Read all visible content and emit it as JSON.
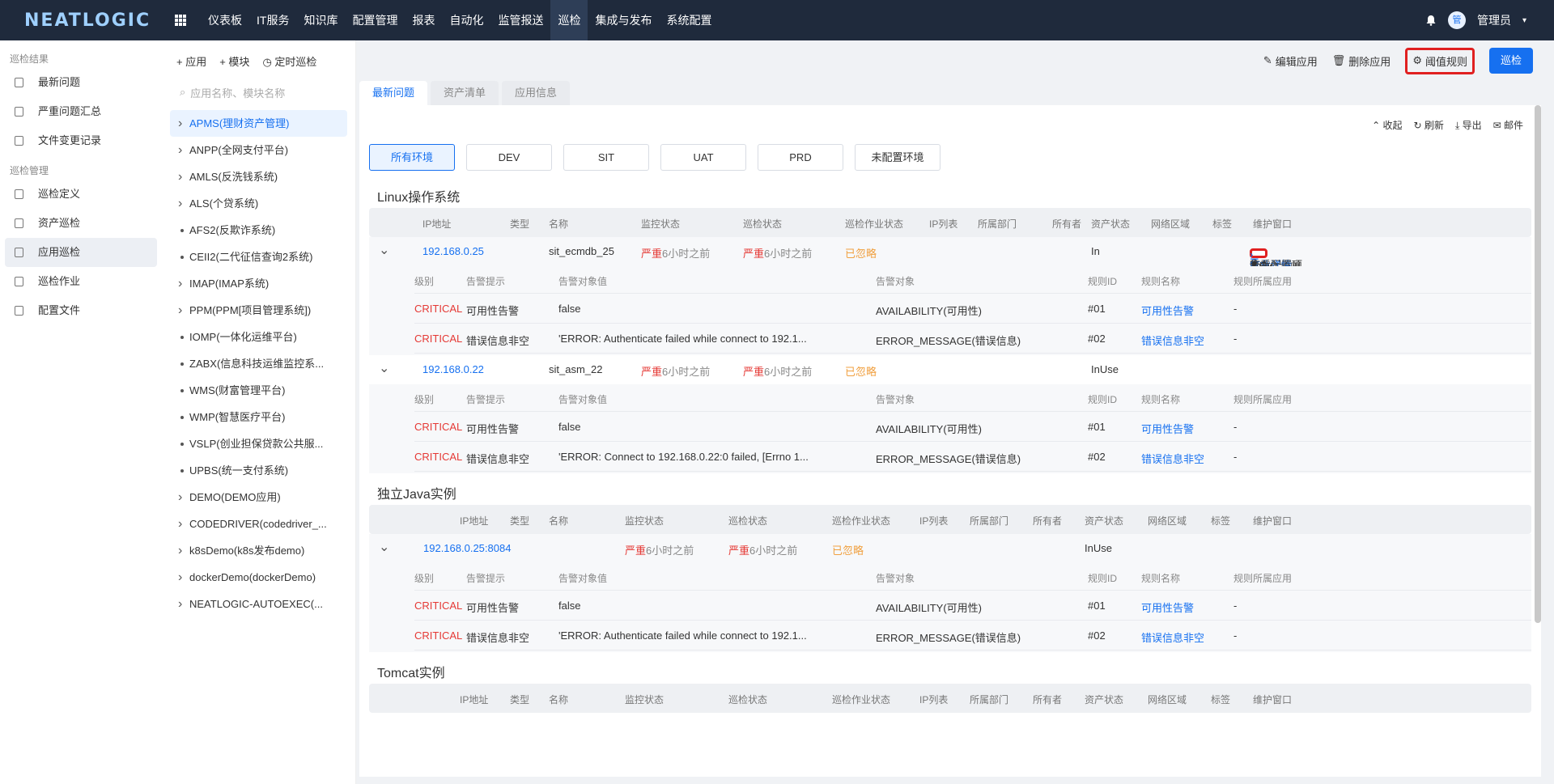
{
  "app": {
    "logo": "NEATLOGIC"
  },
  "topnav": {
    "items": [
      "仪表板",
      "IT服务",
      "知识库",
      "配置管理",
      "报表",
      "自动化",
      "监管报送",
      "巡检",
      "集成与发布",
      "系统配置"
    ],
    "active_index": 7,
    "user": {
      "avatar": "管",
      "name": "管理员"
    }
  },
  "leftnav": {
    "groups": [
      {
        "title": "巡检结果",
        "items": [
          "最新问题",
          "严重问题汇总",
          "文件变更记录"
        ]
      },
      {
        "title": "巡检管理",
        "items": [
          "巡检定义",
          "资产巡检",
          "应用巡检",
          "巡检作业",
          "配置文件"
        ]
      }
    ],
    "active": "应用巡检"
  },
  "tree": {
    "add_app": "+ 应用",
    "add_module": "+ 模块",
    "schedule": "定时巡检",
    "search_placeholder": "应用名称、模块名称",
    "items": [
      {
        "label": "APMS(理财资产管理)",
        "expand": true
      },
      {
        "label": "ANPP(全网支付平台)",
        "expand": true
      },
      {
        "label": "AMLS(反洗钱系统)",
        "expand": true
      },
      {
        "label": "ALS(个贷系统)",
        "expand": true
      },
      {
        "label": "AFS2(反欺诈系统)",
        "expand": false
      },
      {
        "label": "CEII2(二代征信查询2系统)",
        "expand": false
      },
      {
        "label": "IMAP(IMAP系统)",
        "expand": true
      },
      {
        "label": "PPM(PPM[项目管理系统])",
        "expand": true
      },
      {
        "label": "IOMP(一体化运维平台)",
        "expand": false
      },
      {
        "label": "ZABX(信息科技运维监控系...",
        "expand": false
      },
      {
        "label": "WMS(财富管理平台)",
        "expand": false
      },
      {
        "label": "WMP(智慧医疗平台)",
        "expand": false
      },
      {
        "label": "VSLP(创业担保贷款公共服...",
        "expand": false
      },
      {
        "label": "UPBS(统一支付系统)",
        "expand": false
      },
      {
        "label": "DEMO(DEMO应用)",
        "expand": true
      },
      {
        "label": "CODEDRIVER(codedriver_...",
        "expand": true
      },
      {
        "label": "k8sDemo(k8s发布demo)",
        "expand": true
      },
      {
        "label": "dockerDemo(dockerDemo)",
        "expand": true
      },
      {
        "label": "NEATLOGIC-AUTOEXEC(...",
        "expand": true
      }
    ],
    "active_index": 0
  },
  "toolbar": {
    "edit": "编辑应用",
    "delete": "删除应用",
    "threshold": "阈值规则",
    "inspect": "巡检"
  },
  "tabs": [
    "最新问题",
    "资产清单",
    "应用信息"
  ],
  "panel_actions": {
    "collapse": "收起",
    "refresh": "刷新",
    "export": "导出",
    "mail": "邮件"
  },
  "envs": [
    "所有环境",
    "DEV",
    "SIT",
    "UAT",
    "PRD",
    "未配置环境"
  ],
  "columns": [
    "IP地址",
    "类型",
    "名称",
    "监控状态",
    "巡检状态",
    "巡检作业状态",
    "IP列表",
    "所属部门",
    "所有者",
    "资产状态",
    "网络区域",
    "标签",
    "维护窗口"
  ],
  "sub_columns": [
    "级别",
    "告警提示",
    "告警对象值",
    "告警对象",
    "规则ID",
    "规则名称",
    "规则所属应用"
  ],
  "sections": [
    {
      "title": "Linux操作系统",
      "rows": [
        {
          "ip": "192.168.0.25",
          "name": "sit_ecmdb_25",
          "monitor": "严重",
          "monitor_time": "6小时之前",
          "inspect": "严重",
          "inspect_time": "6小时之前",
          "job": "已忽略",
          "asset": "In",
          "row_actions": {
            "threshold": "阈值规则",
            "job_detail": "作业详情",
            "config": "查看配置项"
          },
          "alerts": [
            {
              "level": "CRITICAL",
              "tip": "可用性告警",
              "value": "false",
              "object": "AVAILABILITY(可用性)",
              "rule_id": "#01",
              "rule_name": "可用性告警",
              "rule_app": "-"
            },
            {
              "level": "CRITICAL",
              "tip": "错误信息非空",
              "value": "'ERROR: Authenticate failed while connect to 192.1...",
              "object": "ERROR_MESSAGE(错误信息)",
              "rule_id": "#02",
              "rule_name": "错误信息非空",
              "rule_app": "-"
            }
          ]
        },
        {
          "ip": "192.168.0.22",
          "name": "sit_asm_22",
          "monitor": "严重",
          "monitor_time": "6小时之前",
          "inspect": "严重",
          "inspect_time": "6小时之前",
          "job": "已忽略",
          "asset": "InUse",
          "alerts": [
            {
              "level": "CRITICAL",
              "tip": "可用性告警",
              "value": "false",
              "object": "AVAILABILITY(可用性)",
              "rule_id": "#01",
              "rule_name": "可用性告警",
              "rule_app": "-"
            },
            {
              "level": "CRITICAL",
              "tip": "错误信息非空",
              "value": "'ERROR: Connect to 192.168.0.22:0 failed, [Errno 1...",
              "object": "ERROR_MESSAGE(错误信息)",
              "rule_id": "#02",
              "rule_name": "错误信息非空",
              "rule_app": "-"
            }
          ]
        }
      ]
    },
    {
      "title": "独立Java实例",
      "rows": [
        {
          "ip": "192.168.0.25:8084",
          "name": "",
          "monitor": "严重",
          "monitor_time": "6小时之前",
          "inspect": "严重",
          "inspect_time": "6小时之前",
          "job": "已忽略",
          "asset": "InUse",
          "alerts": [
            {
              "level": "CRITICAL",
              "tip": "可用性告警",
              "value": "false",
              "object": "AVAILABILITY(可用性)",
              "rule_id": "#01",
              "rule_name": "可用性告警",
              "rule_app": "-"
            },
            {
              "level": "CRITICAL",
              "tip": "错误信息非空",
              "value": "'ERROR: Authenticate failed while connect to 192.1...",
              "object": "ERROR_MESSAGE(错误信息)",
              "rule_id": "#02",
              "rule_name": "错误信息非空",
              "rule_app": "-"
            }
          ]
        }
      ]
    },
    {
      "title": "Tomcat实例",
      "rows": []
    }
  ]
}
